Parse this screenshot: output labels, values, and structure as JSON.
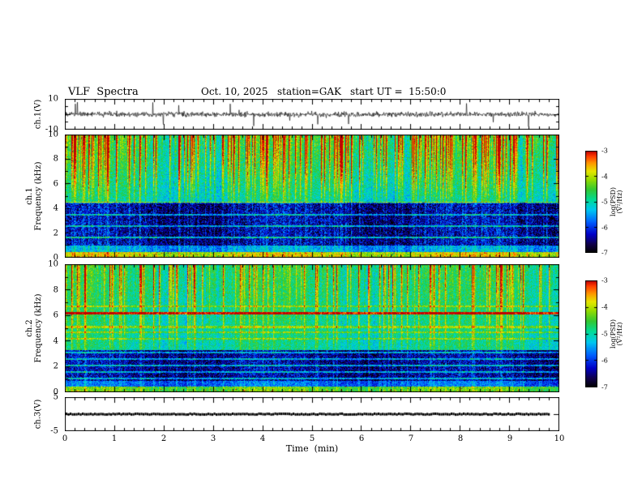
{
  "header": {
    "title": "VLF  Spectra",
    "date": "Oct. 10, 2025",
    "station": "station=GAK",
    "start_ut": "start UT =  15:50:0"
  },
  "xaxis": {
    "label": "Time  (min)",
    "range": [
      0,
      10
    ],
    "ticks": [
      0,
      1,
      2,
      3,
      4,
      5,
      6,
      7,
      8,
      9,
      10
    ],
    "minor_step": 0.2
  },
  "colorbar": {
    "label": "log(PSD)(V²/Hz)",
    "zlim": [
      -7,
      -3
    ],
    "ticks": [
      -3,
      -4,
      -5,
      -6,
      -7
    ],
    "stops": [
      {
        "t": 0.0,
        "c": "#000000"
      },
      {
        "t": 0.08,
        "c": "#10004a"
      },
      {
        "t": 0.18,
        "c": "#0000c8"
      },
      {
        "t": 0.3,
        "c": "#0060ff"
      },
      {
        "t": 0.42,
        "c": "#00c8f0"
      },
      {
        "t": 0.52,
        "c": "#00dc96"
      },
      {
        "t": 0.62,
        "c": "#32c832"
      },
      {
        "t": 0.72,
        "c": "#96dc00"
      },
      {
        "t": 0.8,
        "c": "#e6e600"
      },
      {
        "t": 0.88,
        "c": "#ff9600"
      },
      {
        "t": 0.95,
        "c": "#ff3c00"
      },
      {
        "t": 1.0,
        "c": "#c00000"
      }
    ]
  },
  "chart_data": [
    {
      "type": "line",
      "name": "ch1_waveform",
      "ylabel": "ch.1(V)",
      "xlim": [
        0,
        10
      ],
      "ylim": [
        -10,
        10
      ],
      "yticks": [
        10,
        -10
      ],
      "description": "Broadband ch.1 voltage vs time: continuous noise of about ±1.5 V around 0 with frequent impulsive sferic spikes, mostly downward, reaching about -8 V (some +4 V).",
      "gen": {
        "seed": 1315,
        "noise_sigma": 0.8,
        "spike_prob": 0.016,
        "neg_bias": 0.62,
        "spike_min": 2.5,
        "spike_max": 7.5
      }
    },
    {
      "type": "heatmap",
      "name": "ch1_spectrogram",
      "ylabel": "ch.1\nFrequency  (kHz)",
      "xlim": [
        0,
        10
      ],
      "ylim": [
        0,
        10
      ],
      "zlim": [
        -7,
        -3
      ],
      "yticks": [
        10,
        8,
        6,
        4,
        2,
        0
      ],
      "zlabel": "log(PSD)(V²/Hz)",
      "description": "VLF spectrogram ch.1: dense vertical sferic striations across 0-10 kHz; bright yellow-green band below ~0.5 kHz with red speckles; dark blue/black band ~1-4.5 kHz crossed by faint cyan horizontal lines; green/cyan background above 4.5 kHz with yellow-orange-red impulse columns strongest near 6-10 kHz.",
      "gen": {
        "seed": 101,
        "noise": 0.42,
        "bands": [
          {
            "f0": 0.0,
            "f1": 0.45,
            "base": -4.15
          },
          {
            "f0": 0.45,
            "f1": 0.95,
            "base": -5.7
          },
          {
            "f0": 0.95,
            "f1": 4.5,
            "base": -6.6
          },
          {
            "f0": 4.5,
            "f1": 10.0,
            "base": -5.25
          }
        ],
        "lines": [
          {
            "f": 1.6,
            "w": 0.07,
            "boost": 1.2
          },
          {
            "f": 2.55,
            "w": 0.07,
            "boost": 1.05
          },
          {
            "f": 3.5,
            "w": 0.07,
            "boost": 1.05
          },
          {
            "f": 4.45,
            "w": 0.07,
            "boost": 0.8
          }
        ],
        "impulse": {
          "strong_prob": 0.22,
          "strong_min": 0.9,
          "strong_span": 1.2,
          "weak_max": 0.55,
          "split": 4.5,
          "low_gain": 0.5,
          "high_gain": 1.55
        }
      }
    },
    {
      "type": "heatmap",
      "name": "ch2_spectrogram",
      "ylabel": "ch.2\nFrequency  (kHz)",
      "xlim": [
        0,
        10
      ],
      "ylim": [
        0,
        10
      ],
      "zlim": [
        -7,
        -3
      ],
      "yticks": [
        10,
        8,
        6,
        4,
        2,
        0
      ],
      "zlabel": "log(PSD)(V²/Hz)",
      "description": "VLF spectrogram ch.2: green background with vertical sferic striations; dark blue/black band ~0.8-3.3 kHz with several cyan horizontal harmonic lines; strong yellow-orange horizontal line near 6.2 kHz; bright band below ~0.4 kHz; scattered orange impulses at upper frequencies.",
      "gen": {
        "seed": 202,
        "noise": 0.4,
        "bands": [
          {
            "f0": 0.0,
            "f1": 0.4,
            "base": -4.5
          },
          {
            "f0": 0.4,
            "f1": 0.85,
            "base": -5.9
          },
          {
            "f0": 0.85,
            "f1": 3.3,
            "base": -6.55
          },
          {
            "f0": 3.3,
            "f1": 10.0,
            "base": -5.15
          }
        ],
        "lines": [
          {
            "f": 1.05,
            "w": 0.06,
            "boost": 1.0
          },
          {
            "f": 1.55,
            "w": 0.06,
            "boost": 1.0
          },
          {
            "f": 2.05,
            "w": 0.06,
            "boost": 1.1
          },
          {
            "f": 2.6,
            "w": 0.06,
            "boost": 1.0
          },
          {
            "f": 3.1,
            "w": 0.06,
            "boost": 1.0
          },
          {
            "f": 4.15,
            "w": 0.06,
            "boost": 0.6
          },
          {
            "f": 4.7,
            "w": 0.06,
            "boost": 0.6
          },
          {
            "f": 5.1,
            "w": 0.07,
            "boost": 0.7
          },
          {
            "f": 6.2,
            "w": 0.09,
            "boost": 1.9
          },
          {
            "f": 6.7,
            "w": 0.06,
            "boost": 0.6
          }
        ],
        "impulse": {
          "strong_prob": 0.16,
          "strong_min": 0.8,
          "strong_span": 1.0,
          "weak_max": 0.5,
          "split": 3.3,
          "low_gain": 0.45,
          "high_gain": 1.1
        }
      }
    },
    {
      "type": "line",
      "name": "ch3_waveform",
      "ylabel": "ch.3(V)",
      "xlim": [
        0,
        10
      ],
      "ylim": [
        -5,
        5
      ],
      "yticks": [
        5,
        -5
      ],
      "description": "ch.3 voltage: flat heavy black trace at ~0 V extending from t=0 to about t=9.8 min.",
      "gen": {
        "seed": 9,
        "value": 0,
        "x_end": 9.8,
        "thickness": 3
      }
    }
  ]
}
